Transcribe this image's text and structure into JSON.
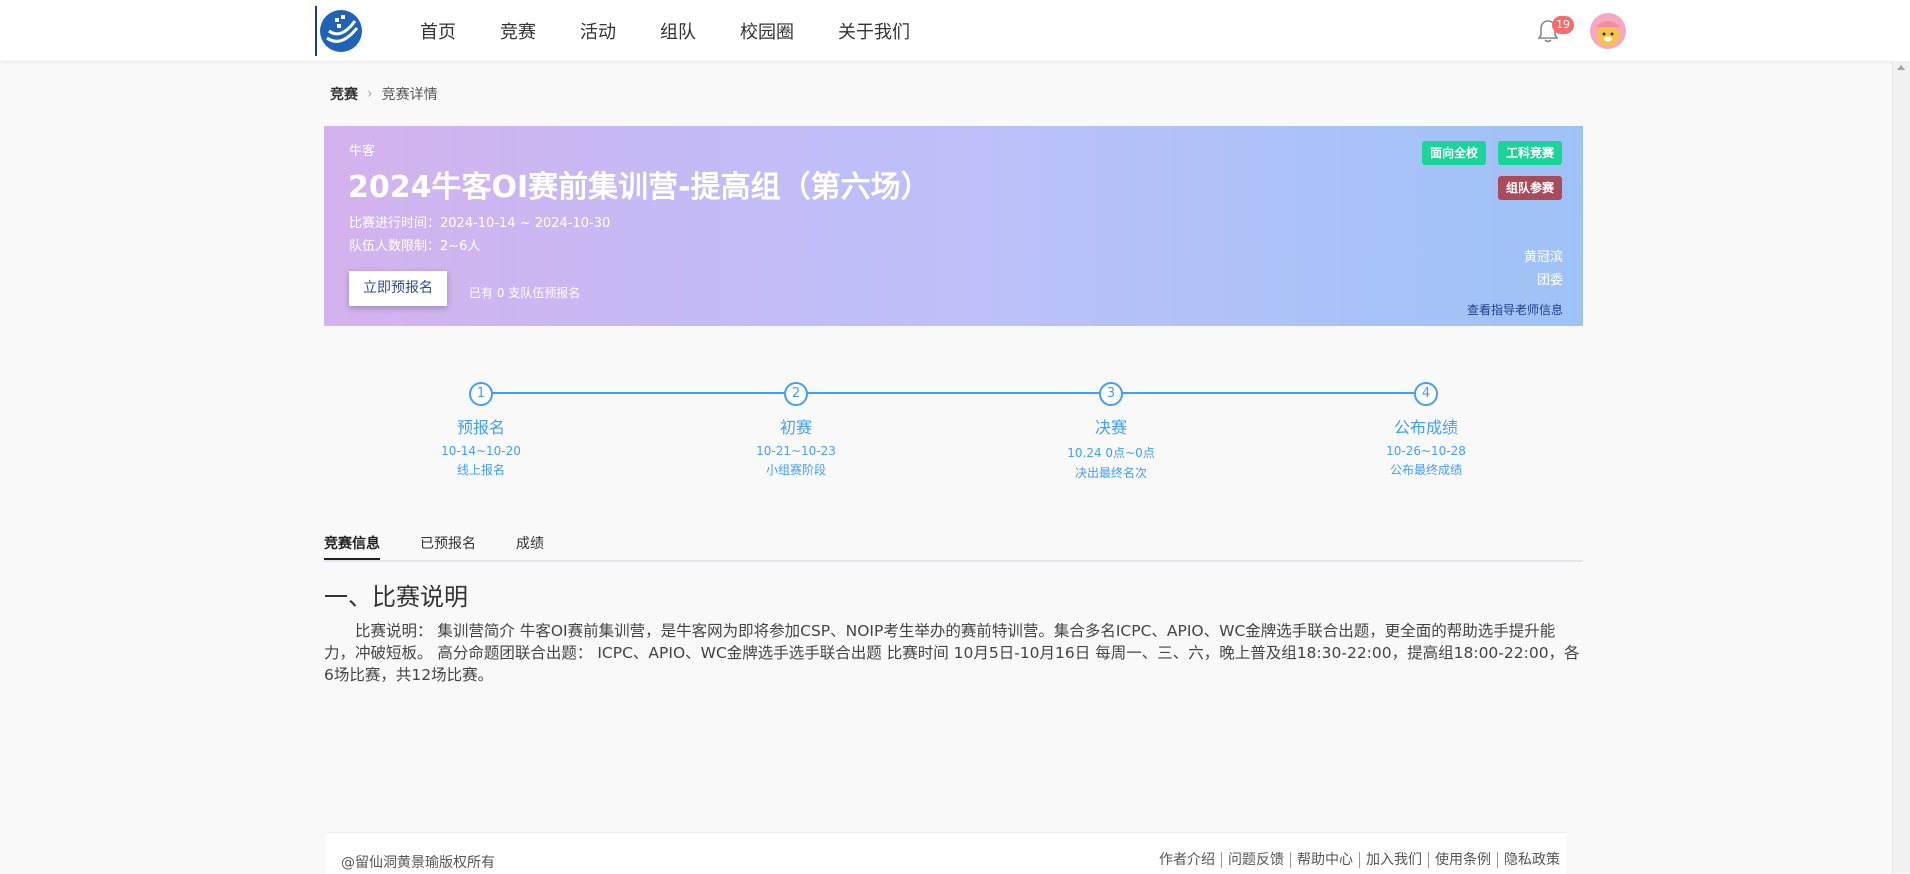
{
  "nav": {
    "items": [
      {
        "label": "首页"
      },
      {
        "label": "竞赛"
      },
      {
        "label": "活动"
      },
      {
        "label": "组队"
      },
      {
        "label": "校园圈"
      },
      {
        "label": "关于我们"
      }
    ],
    "notification_count": "19"
  },
  "breadcrumb": {
    "root": "竞赛",
    "current": "竞赛详情"
  },
  "banner": {
    "org": "牛客",
    "title": "2024牛客OI赛前集训营-提高组（第六场）",
    "time": "比赛进行时间：2024-10-14 ~ 2024-10-30",
    "team_size": "队伍人数限制：2~6人",
    "signup_button": "立即预报名",
    "signup_count": "已有 0 支队伍预报名",
    "tags": [
      "面向全校",
      "工科竞赛",
      "组队参赛"
    ],
    "teacher": "黄冠滨",
    "unit": "团委",
    "teacher_link": "查看指导老师信息",
    "accent_color": "#409eff"
  },
  "steps": [
    {
      "num": "1",
      "title": "预报名",
      "date": "10-14~10-20",
      "desc": "线上报名"
    },
    {
      "num": "2",
      "title": "初赛",
      "date": "10-21~10-23",
      "desc": "小组赛阶段"
    },
    {
      "num": "3",
      "title": "决赛",
      "date": "10.24 0点~0点",
      "desc": "决出最终名次"
    },
    {
      "num": "4",
      "title": "公布成绩",
      "date": "10-26~10-28",
      "desc": "公布最终成绩"
    }
  ],
  "tabs": [
    {
      "label": "竞赛信息"
    },
    {
      "label": "已预报名"
    },
    {
      "label": "成绩"
    }
  ],
  "content": {
    "section_title": "一、比赛说明",
    "body": "比赛说明： 集训营简介 牛客OI赛前集训营，是牛客网为即将参加CSP、NOIP考生举办的赛前特训营。集合多名ICPC、APIO、WC金牌选手联合出题，更全面的帮助选手提升能力，冲破短板。 高分命题团联合出题： ICPC、APIO、WC金牌选手选手联合出题 比赛时间 10月5日-10月16日 每周一、三、六，晚上普及组18:30-22:00，提高组18:00-22:00，各6场比赛，共12场比赛。"
  },
  "footer": {
    "copyright": "@留仙洞黄景瑜版权所有",
    "links": [
      "作者介绍",
      "问题反馈",
      "帮助中心",
      "加入我们",
      "使用条例",
      "隐私政策"
    ]
  }
}
